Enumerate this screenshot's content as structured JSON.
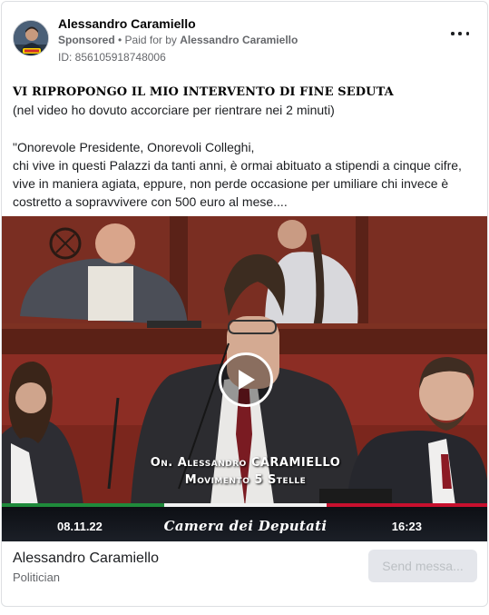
{
  "post": {
    "author": "Alessandro Caramiello",
    "sponsored_label": "Sponsored",
    "paid_prefix": "• Paid for by",
    "paid_by": "Alessandro Caramiello",
    "ad_id": "ID: 856105918748006",
    "more_icon": "more-horizontal-icon",
    "headline": "VI RIPROPONGO IL MIO INTERVENTO DI FINE SEDUTA",
    "subline": "(nel video ho dovuto accorciare per rientrare nei 2 minuti)",
    "body": "\"Onorevole Presidente, Onorevoli Colleghi,\nchi vive in questi Palazzi da tanti anni, è ormai abituato a stipendi a cinque cifre, vive in maniera agiata, eppure, non perde occasione per umiliare chi invece è costretto a sopravvivere con 500 euro al mese...."
  },
  "video": {
    "caption_line1": "On. Alessandro CARAMIELLO",
    "caption_line2": "Movimento 5 Stelle",
    "date": "08.11.22",
    "channel": "Camera dei Deputati",
    "time": "16:23",
    "play_icon": "play-icon",
    "colors": {
      "green": "#1f8a3b",
      "white": "#f2f2f2",
      "red": "#c8102e"
    }
  },
  "footer": {
    "page_name": "Alessandro Caramiello",
    "category": "Politician",
    "button_label": "Send messa..."
  }
}
